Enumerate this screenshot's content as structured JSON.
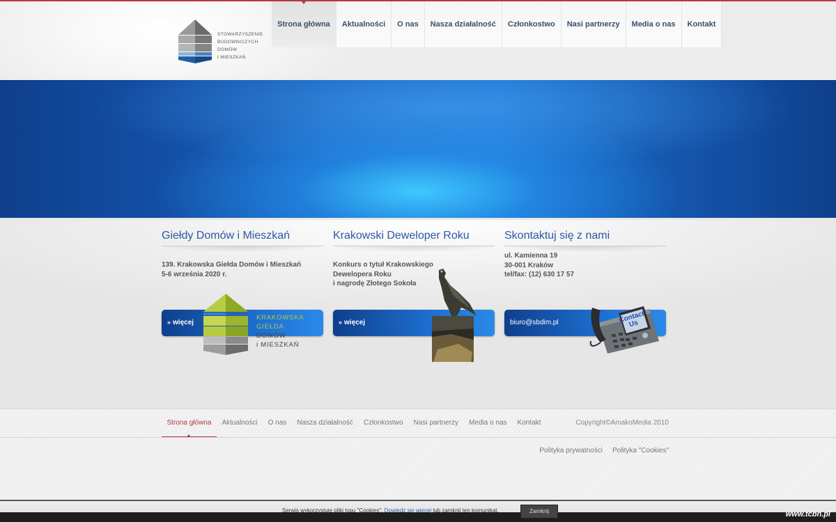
{
  "header": {
    "logo_text": [
      "STOWARZYSZENIE",
      "BUDOWNICZYCH",
      "DOMÓW",
      "I MIESZKAŃ"
    ],
    "nav": [
      {
        "label": "Strona główna",
        "active": true
      },
      {
        "label": "Aktualności"
      },
      {
        "label": "O nas"
      },
      {
        "label": "Nasza działalność"
      },
      {
        "label": "Członkostwo"
      },
      {
        "label": "Nasi partnerzy"
      },
      {
        "label": "Media o nas"
      },
      {
        "label": "Kontakt"
      }
    ]
  },
  "columns": {
    "fairs": {
      "title": "Giełdy Domów i Mieszkań",
      "lines": [
        "139. Krakowska Giełda Domów i Mieszkań",
        "5-6 września 2020 r."
      ],
      "button": "więcej",
      "badge_text": [
        "KRAKOWSKA",
        "GIEŁDA",
        "DOMÓW",
        "i MIESZKAŃ"
      ]
    },
    "developer": {
      "title": "Krakowski Deweloper Roku",
      "lines": [
        "Konkurs o tytuł Krakowskiego",
        "Dewelopera Roku",
        "i nagrodę Złotego Sokoła"
      ],
      "button": "więcej"
    },
    "contact": {
      "title": "Skontaktuj się z nami",
      "lines": [
        "ul. Kamienna 19",
        "30-001 Kraków",
        "tel/fax: (12) 630 17 57"
      ],
      "email": "biuro@sbdim.pl",
      "phone_screen": [
        "Contact",
        "Us"
      ]
    }
  },
  "footer": {
    "nav": [
      {
        "label": "Strona główna",
        "active": true
      },
      {
        "label": "Aktualności"
      },
      {
        "label": "O nas"
      },
      {
        "label": "Nasza działalność"
      },
      {
        "label": "Członkostwo"
      },
      {
        "label": "Nasi partnerzy"
      },
      {
        "label": "Media o nas"
      },
      {
        "label": "Kontakt"
      }
    ],
    "copyright": "Copyright©AmakoMedia 2010",
    "policies": [
      "Polityka prywatności",
      "Polityka \"Cookies\""
    ]
  },
  "cookie": {
    "message_start": "Serwis wykorzystuje pliki typu \"Cookies\". ",
    "link": "Dowiedz się więcej",
    "message_end": " lub zamknij ten komunikat.",
    "button": "Zamknij"
  },
  "watermark": "www.tcbn.pl",
  "colors": {
    "accent_red": "#b33a45",
    "title_blue": "#2a5aa0",
    "banner_blue": "#1760bf",
    "kg_green": "#a8c23a"
  }
}
